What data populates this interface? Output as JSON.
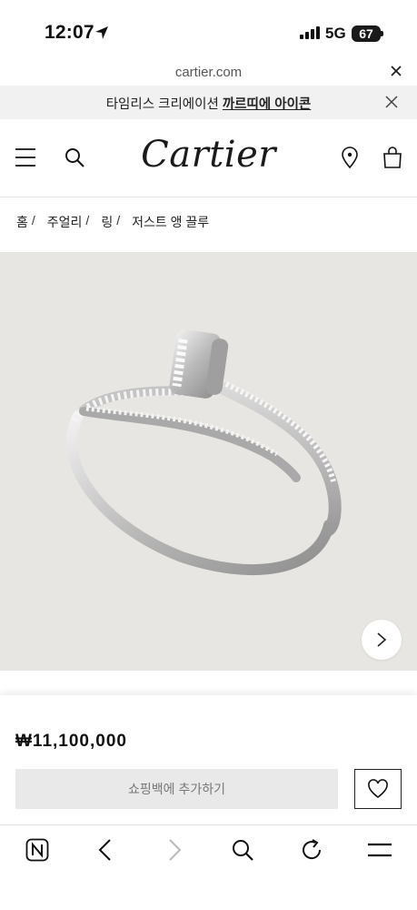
{
  "status": {
    "time": "12:07",
    "network": "5G",
    "battery": "67"
  },
  "browser": {
    "url": "cartier.com"
  },
  "promo": {
    "text": "타임리스 크리에이션 ",
    "link": "까르띠에 아이콘"
  },
  "header": {
    "logo": "Cartier"
  },
  "breadcrumb": {
    "items": [
      "홈",
      "주얼리",
      "링",
      "저스트 앵 끌루"
    ],
    "separator": "/"
  },
  "product": {
    "price": "₩11,100,000",
    "add_to_bag": "쇼핑백에 추가하기"
  },
  "colors": {
    "image_bg": "#e8e6e2",
    "promo_bg": "#f1f1f1",
    "button_bg": "#e9e9e9"
  },
  "toolbar": {
    "icons": [
      "naver-icon",
      "back-icon",
      "forward-icon",
      "search-icon",
      "refresh-icon",
      "menu-icon"
    ]
  }
}
